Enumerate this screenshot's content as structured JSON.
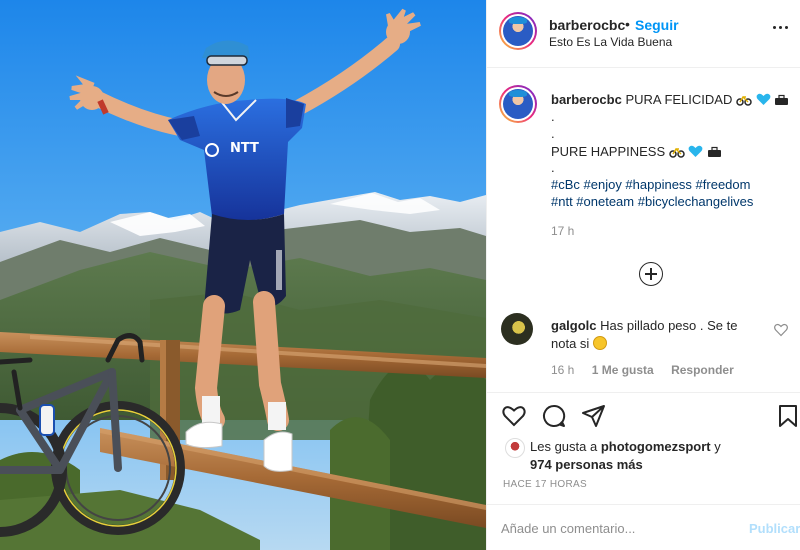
{
  "post": {
    "username": "barberocbc",
    "follow_label": "Seguir",
    "location": "Esto Es La Vida Buena",
    "caption_line1": "PURA FELICIDAD",
    "caption_dot1": ".",
    "caption_dot2": ".",
    "caption_line2": "PURE HAPPINESS",
    "caption_dot3": ".",
    "hashtags_line1": "#cBc #enjoy #happiness #freedom",
    "hashtags_line2": "#ntt #oneteam #bicyclechangelives",
    "caption_time": "17 h",
    "photo_jersey_text": "NTT"
  },
  "comment": {
    "username": "galgolc",
    "text": "Has pillado peso . Se te nota si",
    "time": "16 h",
    "likes": "1 Me gusta",
    "reply_label": "Responder"
  },
  "likes": {
    "prefix": "Les gusta a",
    "user": "photogomezsport",
    "connector": "y",
    "others": "974 personas más"
  },
  "posted_ago": "HACE 17 HORAS",
  "composer": {
    "placeholder": "Añade un comentario...",
    "publish_label": "Publicar"
  },
  "icons": {
    "caption_emojis": [
      "bicycle-icon",
      "blue-heart-icon",
      "briefcase-icon"
    ],
    "actions": [
      "heart-icon",
      "comment-icon",
      "share-icon",
      "bookmark-icon"
    ]
  },
  "colors": {
    "link_blue": "#0095f6",
    "hashtag_blue": "#00376b",
    "muted_gray": "#8e8e8e",
    "publish_disabled": "#b2dffc"
  }
}
